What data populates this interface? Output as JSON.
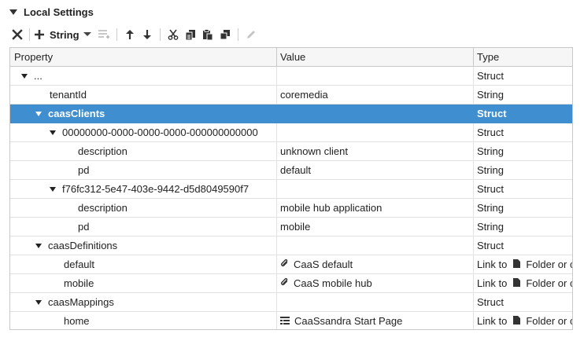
{
  "panel": {
    "title": "Local Settings"
  },
  "toolbar": {
    "type_label": "String"
  },
  "columns": {
    "property": "Property",
    "value": "Value",
    "type": "Type"
  },
  "rows": [
    {
      "property": "...",
      "value": "",
      "type": "Struct",
      "expandable": true
    },
    {
      "property": "tenantId",
      "value": "coremedia",
      "type": "String"
    },
    {
      "property": "caasClients",
      "value": "",
      "type": "Struct",
      "expandable": true,
      "selected": true
    },
    {
      "property": "00000000-0000-0000-0000-000000000000",
      "value": "",
      "type": "Struct",
      "expandable": true
    },
    {
      "property": "description",
      "value": "unknown client",
      "type": "String"
    },
    {
      "property": "pd",
      "value": "default",
      "type": "String"
    },
    {
      "property": "f76fc312-5e47-403e-9442-d5d8049590f7",
      "value": "",
      "type": "Struct",
      "expandable": true
    },
    {
      "property": "description",
      "value": "mobile hub application",
      "type": "String"
    },
    {
      "property": "pd",
      "value": "mobile",
      "type": "String"
    },
    {
      "property": "caasDefinitions",
      "value": "",
      "type": "Struct",
      "expandable": true
    },
    {
      "property": "default",
      "value": "CaaS default",
      "value_icon": "paperclip-icon",
      "type": "Link to",
      "type_suffix": "Folder or c"
    },
    {
      "property": "mobile",
      "value": "CaaS mobile hub",
      "value_icon": "paperclip-icon",
      "type": "Link to",
      "type_suffix": "Folder or c"
    },
    {
      "property": "caasMappings",
      "value": "",
      "type": "Struct",
      "expandable": true
    },
    {
      "property": "home",
      "value": "CaaSsandra Start Page",
      "value_icon": "page-list-icon",
      "type": "Link to",
      "type_suffix": "Folder or c"
    }
  ],
  "colors": {
    "selection": "#3e8ed0",
    "border": "#c8c8c8"
  }
}
